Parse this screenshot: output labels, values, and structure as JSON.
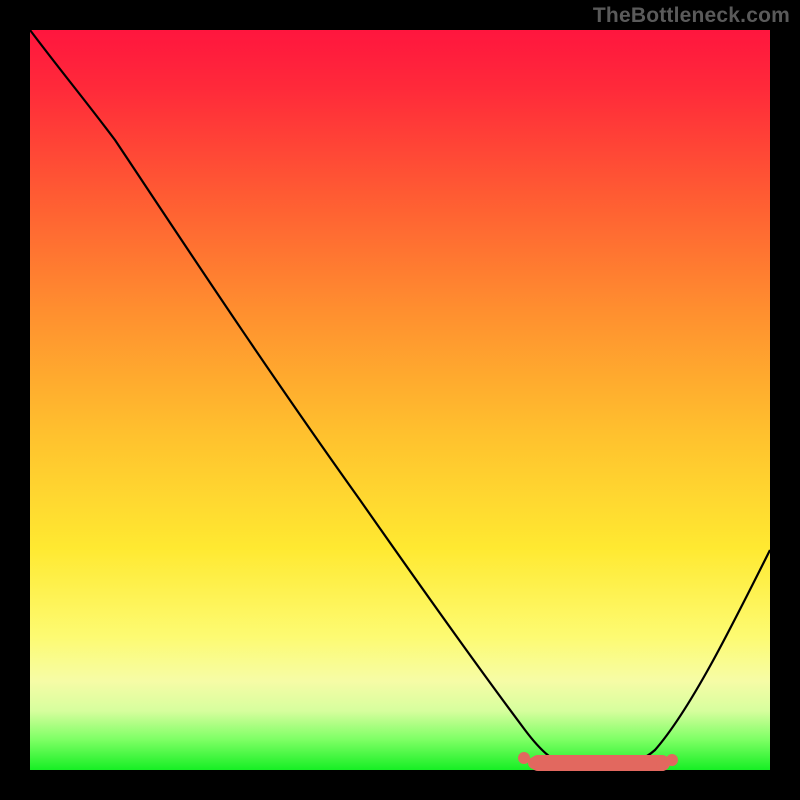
{
  "watermark": "TheBottleneck.com",
  "colors": {
    "curve_stroke": "#000000",
    "marker_fill": "#e2685f",
    "background": "#000000"
  },
  "chart_data": {
    "type": "line",
    "title": "",
    "xlabel": "",
    "ylabel": "",
    "xlim": [
      0,
      100
    ],
    "ylim": [
      0,
      100
    ],
    "grid": false,
    "legend": false,
    "background_gradient": {
      "direction": "vertical",
      "stops": [
        {
          "pos": 0,
          "color": "#ff163e"
        },
        {
          "pos": 22,
          "color": "#ff5a33"
        },
        {
          "pos": 55,
          "color": "#ffc22e"
        },
        {
          "pos": 82,
          "color": "#fdfb72"
        },
        {
          "pos": 100,
          "color": "#16ef24"
        }
      ]
    },
    "series": [
      {
        "name": "bottleneck-curve",
        "x": [
          0,
          4,
          8,
          12,
          20,
          30,
          40,
          50,
          58,
          62,
          66,
          70,
          74,
          78,
          82,
          86,
          90,
          94,
          98,
          100
        ],
        "y": [
          100,
          96,
          92,
          88,
          78,
          64,
          51,
          37,
          25,
          18,
          11,
          5,
          1,
          0,
          0,
          3,
          10,
          20,
          32,
          38
        ]
      }
    ],
    "markers": {
      "name": "optimal-range",
      "type": "blob",
      "x_range": [
        67,
        87
      ],
      "y": 2
    }
  }
}
